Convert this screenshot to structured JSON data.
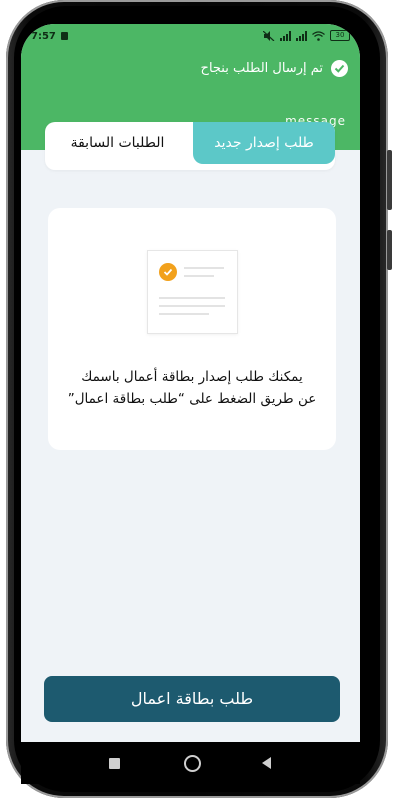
{
  "status_bar": {
    "time": "7:57",
    "battery": "30",
    "icons": [
      "sim-icon",
      "mute-icon",
      "signal-icon",
      "signal-icon",
      "wifi-icon",
      "battery-icon"
    ]
  },
  "toast": {
    "title": "تم إرسال الطلب بنجاح",
    "message": "message",
    "icon": "check-circle-icon",
    "color": "#4cb765"
  },
  "tabs": [
    {
      "label": "طلب إصدار جديد",
      "active": true
    },
    {
      "label": "الطلبات السابقة",
      "active": false
    }
  ],
  "info_card": {
    "line1": "يمكنك طلب إصدار بطاقة أعمال باسمك",
    "line2": "عن طريق الضغط على “طلب بطاقة اعمال”",
    "illustration": "document-check-icon"
  },
  "cta": {
    "label": "طلب بطاقة اعمال",
    "color": "#1d5a6f"
  },
  "nav_bar": {
    "icons": [
      "recents-icon",
      "home-icon",
      "back-icon"
    ]
  },
  "colors": {
    "accent_tab": "#5cc8c8",
    "background": "#eff3f7",
    "badge_orange": "#f2a11c"
  }
}
